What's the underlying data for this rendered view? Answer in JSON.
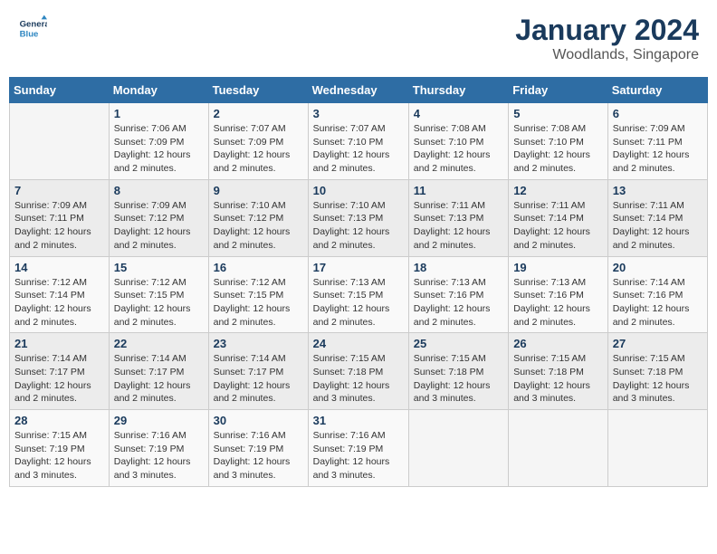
{
  "header": {
    "logo_general": "General",
    "logo_blue": "Blue",
    "month_title": "January 2024",
    "location": "Woodlands, Singapore"
  },
  "weekdays": [
    "Sunday",
    "Monday",
    "Tuesday",
    "Wednesday",
    "Thursday",
    "Friday",
    "Saturday"
  ],
  "weeks": [
    [
      {
        "day": "",
        "sunrise": "",
        "sunset": "",
        "daylight": ""
      },
      {
        "day": "1",
        "sunrise": "Sunrise: 7:06 AM",
        "sunset": "Sunset: 7:09 PM",
        "daylight": "Daylight: 12 hours and 2 minutes."
      },
      {
        "day": "2",
        "sunrise": "Sunrise: 7:07 AM",
        "sunset": "Sunset: 7:09 PM",
        "daylight": "Daylight: 12 hours and 2 minutes."
      },
      {
        "day": "3",
        "sunrise": "Sunrise: 7:07 AM",
        "sunset": "Sunset: 7:10 PM",
        "daylight": "Daylight: 12 hours and 2 minutes."
      },
      {
        "day": "4",
        "sunrise": "Sunrise: 7:08 AM",
        "sunset": "Sunset: 7:10 PM",
        "daylight": "Daylight: 12 hours and 2 minutes."
      },
      {
        "day": "5",
        "sunrise": "Sunrise: 7:08 AM",
        "sunset": "Sunset: 7:10 PM",
        "daylight": "Daylight: 12 hours and 2 minutes."
      },
      {
        "day": "6",
        "sunrise": "Sunrise: 7:09 AM",
        "sunset": "Sunset: 7:11 PM",
        "daylight": "Daylight: 12 hours and 2 minutes."
      }
    ],
    [
      {
        "day": "7",
        "sunrise": "Sunrise: 7:09 AM",
        "sunset": "Sunset: 7:11 PM",
        "daylight": "Daylight: 12 hours and 2 minutes."
      },
      {
        "day": "8",
        "sunrise": "Sunrise: 7:09 AM",
        "sunset": "Sunset: 7:12 PM",
        "daylight": "Daylight: 12 hours and 2 minutes."
      },
      {
        "day": "9",
        "sunrise": "Sunrise: 7:10 AM",
        "sunset": "Sunset: 7:12 PM",
        "daylight": "Daylight: 12 hours and 2 minutes."
      },
      {
        "day": "10",
        "sunrise": "Sunrise: 7:10 AM",
        "sunset": "Sunset: 7:13 PM",
        "daylight": "Daylight: 12 hours and 2 minutes."
      },
      {
        "day": "11",
        "sunrise": "Sunrise: 7:11 AM",
        "sunset": "Sunset: 7:13 PM",
        "daylight": "Daylight: 12 hours and 2 minutes."
      },
      {
        "day": "12",
        "sunrise": "Sunrise: 7:11 AM",
        "sunset": "Sunset: 7:14 PM",
        "daylight": "Daylight: 12 hours and 2 minutes."
      },
      {
        "day": "13",
        "sunrise": "Sunrise: 7:11 AM",
        "sunset": "Sunset: 7:14 PM",
        "daylight": "Daylight: 12 hours and 2 minutes."
      }
    ],
    [
      {
        "day": "14",
        "sunrise": "Sunrise: 7:12 AM",
        "sunset": "Sunset: 7:14 PM",
        "daylight": "Daylight: 12 hours and 2 minutes."
      },
      {
        "day": "15",
        "sunrise": "Sunrise: 7:12 AM",
        "sunset": "Sunset: 7:15 PM",
        "daylight": "Daylight: 12 hours and 2 minutes."
      },
      {
        "day": "16",
        "sunrise": "Sunrise: 7:12 AM",
        "sunset": "Sunset: 7:15 PM",
        "daylight": "Daylight: 12 hours and 2 minutes."
      },
      {
        "day": "17",
        "sunrise": "Sunrise: 7:13 AM",
        "sunset": "Sunset: 7:15 PM",
        "daylight": "Daylight: 12 hours and 2 minutes."
      },
      {
        "day": "18",
        "sunrise": "Sunrise: 7:13 AM",
        "sunset": "Sunset: 7:16 PM",
        "daylight": "Daylight: 12 hours and 2 minutes."
      },
      {
        "day": "19",
        "sunrise": "Sunrise: 7:13 AM",
        "sunset": "Sunset: 7:16 PM",
        "daylight": "Daylight: 12 hours and 2 minutes."
      },
      {
        "day": "20",
        "sunrise": "Sunrise: 7:14 AM",
        "sunset": "Sunset: 7:16 PM",
        "daylight": "Daylight: 12 hours and 2 minutes."
      }
    ],
    [
      {
        "day": "21",
        "sunrise": "Sunrise: 7:14 AM",
        "sunset": "Sunset: 7:17 PM",
        "daylight": "Daylight: 12 hours and 2 minutes."
      },
      {
        "day": "22",
        "sunrise": "Sunrise: 7:14 AM",
        "sunset": "Sunset: 7:17 PM",
        "daylight": "Daylight: 12 hours and 2 minutes."
      },
      {
        "day": "23",
        "sunrise": "Sunrise: 7:14 AM",
        "sunset": "Sunset: 7:17 PM",
        "daylight": "Daylight: 12 hours and 2 minutes."
      },
      {
        "day": "24",
        "sunrise": "Sunrise: 7:15 AM",
        "sunset": "Sunset: 7:18 PM",
        "daylight": "Daylight: 12 hours and 3 minutes."
      },
      {
        "day": "25",
        "sunrise": "Sunrise: 7:15 AM",
        "sunset": "Sunset: 7:18 PM",
        "daylight": "Daylight: 12 hours and 3 minutes."
      },
      {
        "day": "26",
        "sunrise": "Sunrise: 7:15 AM",
        "sunset": "Sunset: 7:18 PM",
        "daylight": "Daylight: 12 hours and 3 minutes."
      },
      {
        "day": "27",
        "sunrise": "Sunrise: 7:15 AM",
        "sunset": "Sunset: 7:18 PM",
        "daylight": "Daylight: 12 hours and 3 minutes."
      }
    ],
    [
      {
        "day": "28",
        "sunrise": "Sunrise: 7:15 AM",
        "sunset": "Sunset: 7:19 PM",
        "daylight": "Daylight: 12 hours and 3 minutes."
      },
      {
        "day": "29",
        "sunrise": "Sunrise: 7:16 AM",
        "sunset": "Sunset: 7:19 PM",
        "daylight": "Daylight: 12 hours and 3 minutes."
      },
      {
        "day": "30",
        "sunrise": "Sunrise: 7:16 AM",
        "sunset": "Sunset: 7:19 PM",
        "daylight": "Daylight: 12 hours and 3 minutes."
      },
      {
        "day": "31",
        "sunrise": "Sunrise: 7:16 AM",
        "sunset": "Sunset: 7:19 PM",
        "daylight": "Daylight: 12 hours and 3 minutes."
      },
      {
        "day": "",
        "sunrise": "",
        "sunset": "",
        "daylight": ""
      },
      {
        "day": "",
        "sunrise": "",
        "sunset": "",
        "daylight": ""
      },
      {
        "day": "",
        "sunrise": "",
        "sunset": "",
        "daylight": ""
      }
    ]
  ]
}
